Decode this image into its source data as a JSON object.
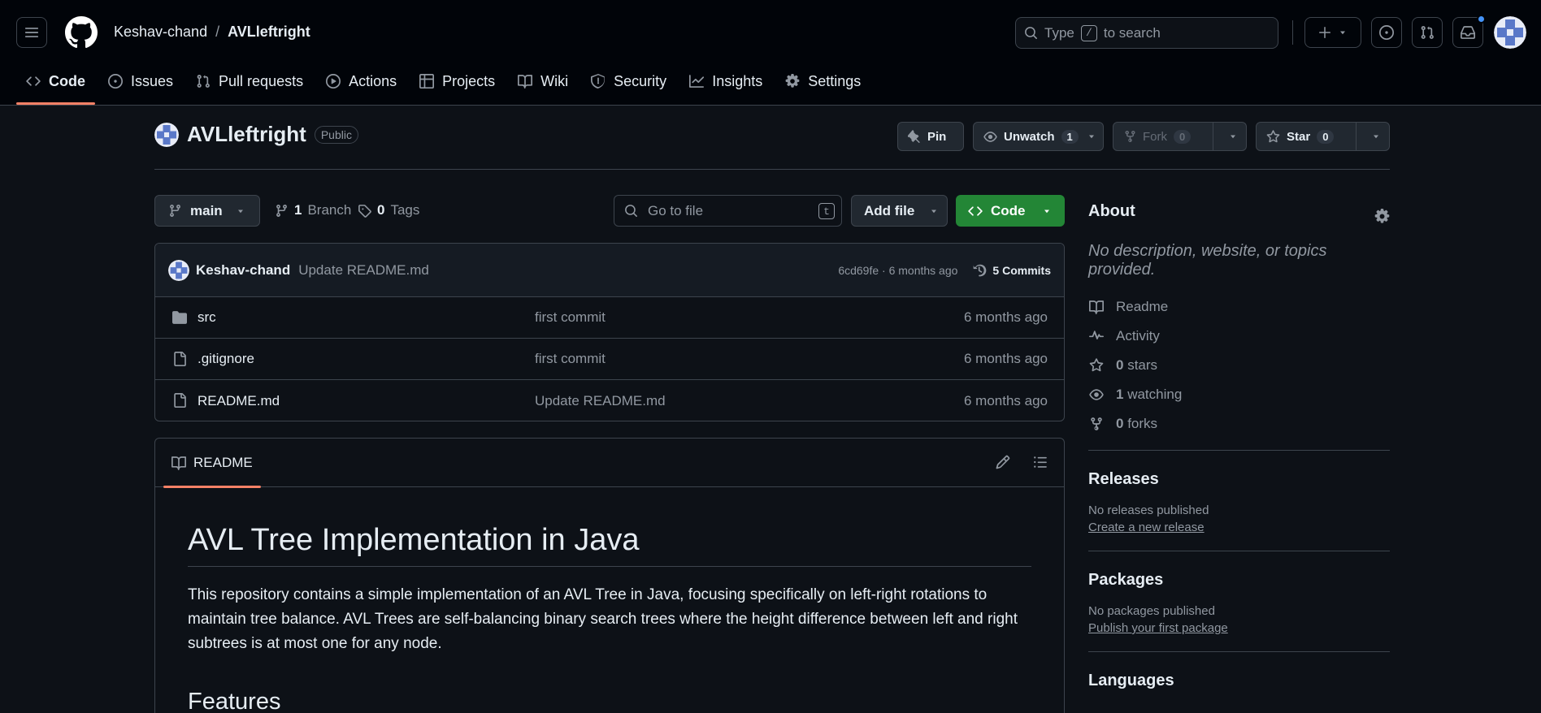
{
  "header": {
    "owner": "Keshav-chand",
    "separator": "/",
    "repo": "AVLleftright",
    "search": {
      "prefix": "Type",
      "key": "/",
      "suffix": "to search"
    }
  },
  "tabs": [
    {
      "label": "Code",
      "icon": "code-icon",
      "active": true
    },
    {
      "label": "Issues",
      "icon": "issue-icon"
    },
    {
      "label": "Pull requests",
      "icon": "pull-request-icon"
    },
    {
      "label": "Actions",
      "icon": "play-icon"
    },
    {
      "label": "Projects",
      "icon": "table-icon"
    },
    {
      "label": "Wiki",
      "icon": "book-icon"
    },
    {
      "label": "Security",
      "icon": "shield-icon"
    },
    {
      "label": "Insights",
      "icon": "graph-icon"
    },
    {
      "label": "Settings",
      "icon": "gear-icon"
    }
  ],
  "repo_header": {
    "name": "AVLleftright",
    "visibility": "Public",
    "pin_label": "Pin",
    "unwatch_label": "Unwatch",
    "watch_count": "1",
    "fork_label": "Fork",
    "fork_count": "0",
    "star_label": "Star",
    "star_count": "0"
  },
  "file_nav": {
    "branch": "main",
    "branch_count": "1",
    "branch_label": "Branch",
    "tag_count": "0",
    "tag_label": "Tags",
    "goto_placeholder": "Go to file",
    "goto_key": "t",
    "add_file_label": "Add file",
    "code_label": "Code"
  },
  "latest_commit": {
    "author": "Keshav-chand",
    "message": "Update README.md",
    "hash_time": "6cd69fe · 6 months ago",
    "commits_label": "5 Commits"
  },
  "files": [
    {
      "name": "src",
      "type": "folder",
      "message": "first commit",
      "date": "6 months ago"
    },
    {
      "name": ".gitignore",
      "type": "file",
      "message": "first commit",
      "date": "6 months ago"
    },
    {
      "name": "README.md",
      "type": "file",
      "message": "Update README.md",
      "date": "6 months ago"
    }
  ],
  "readme": {
    "tab_label": "README",
    "title": "AVL Tree Implementation in Java",
    "paragraph": "This repository contains a simple implementation of an AVL Tree in Java, focusing specifically on left-right rotations to maintain tree balance. AVL Trees are self-balancing binary search trees where the height difference between left and right subtrees is at most one for any node.",
    "section": "Features"
  },
  "sidebar": {
    "about_title": "About",
    "description": "No description, website, or topics provided.",
    "items": [
      {
        "icon": "book-icon",
        "count": "",
        "label": "Readme"
      },
      {
        "icon": "pulse-icon",
        "count": "",
        "label": "Activity"
      },
      {
        "icon": "star-icon",
        "count": "0",
        "label": "stars"
      },
      {
        "icon": "eye-icon",
        "count": "1",
        "label": "watching"
      },
      {
        "icon": "fork-icon",
        "count": "0",
        "label": "forks"
      }
    ],
    "releases_title": "Releases",
    "releases_none": "No releases published",
    "releases_link": "Create a new release",
    "packages_title": "Packages",
    "packages_none": "No packages published",
    "packages_link": "Publish your first package",
    "languages_title": "Languages"
  },
  "colors": {
    "bg": "#0d1117",
    "header_bg": "#010409",
    "border": "#3d444d",
    "accent_tab": "#f78166",
    "code_button": "#238636",
    "link": "#4493f8"
  }
}
